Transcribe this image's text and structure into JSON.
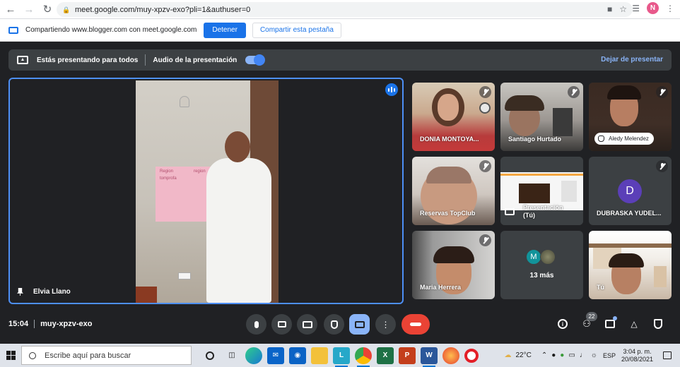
{
  "browser": {
    "url": "meet.google.com/muy-xpzv-exo?pli=1&authuser=0",
    "profile_initial": "N"
  },
  "share_bar": {
    "message": "Compartiendo www.blogger.com con meet.google.com",
    "stop_label": "Detener",
    "share_tab_label": "Compartir esta pestaña"
  },
  "presenting_bar": {
    "presenting_label": "Estás presentando para todos",
    "audio_label": "Audio de la presentación",
    "stop_presenting_label": "Dejar de presentar"
  },
  "main_tile": {
    "name": "Elvia Llano",
    "poster_text_1": "Region",
    "poster_text_2": "region",
    "poster_text_3": "tomprofa"
  },
  "participants": [
    {
      "name": "DONIA MONTOYA..."
    },
    {
      "name": "Santiago Hurtado"
    },
    {
      "name": "Aledy Melendez"
    },
    {
      "name": "Reservas TopClub"
    },
    {
      "name": "Presentación",
      "sub": "(Tú)"
    },
    {
      "name": "DUBRASKA YUDEL...",
      "initial": "D"
    },
    {
      "name": "Maria Herrera"
    },
    {
      "name": "13 más",
      "initial": "M"
    },
    {
      "name": "Tú"
    }
  ],
  "bottom_bar": {
    "time": "15:04",
    "meeting_code": "muy-xpzv-exo",
    "people_count": "22"
  },
  "taskbar": {
    "search_placeholder": "Escribe aquí para buscar",
    "temperature": "22°C",
    "language": "ESP",
    "clock_time": "3:04 p. m.",
    "clock_date": "20/08/2021"
  },
  "colors": {
    "accent_blue": "#1a73e8",
    "hangup_red": "#ea4335",
    "meet_dark": "#202124",
    "tile_gray": "#3c4043"
  }
}
